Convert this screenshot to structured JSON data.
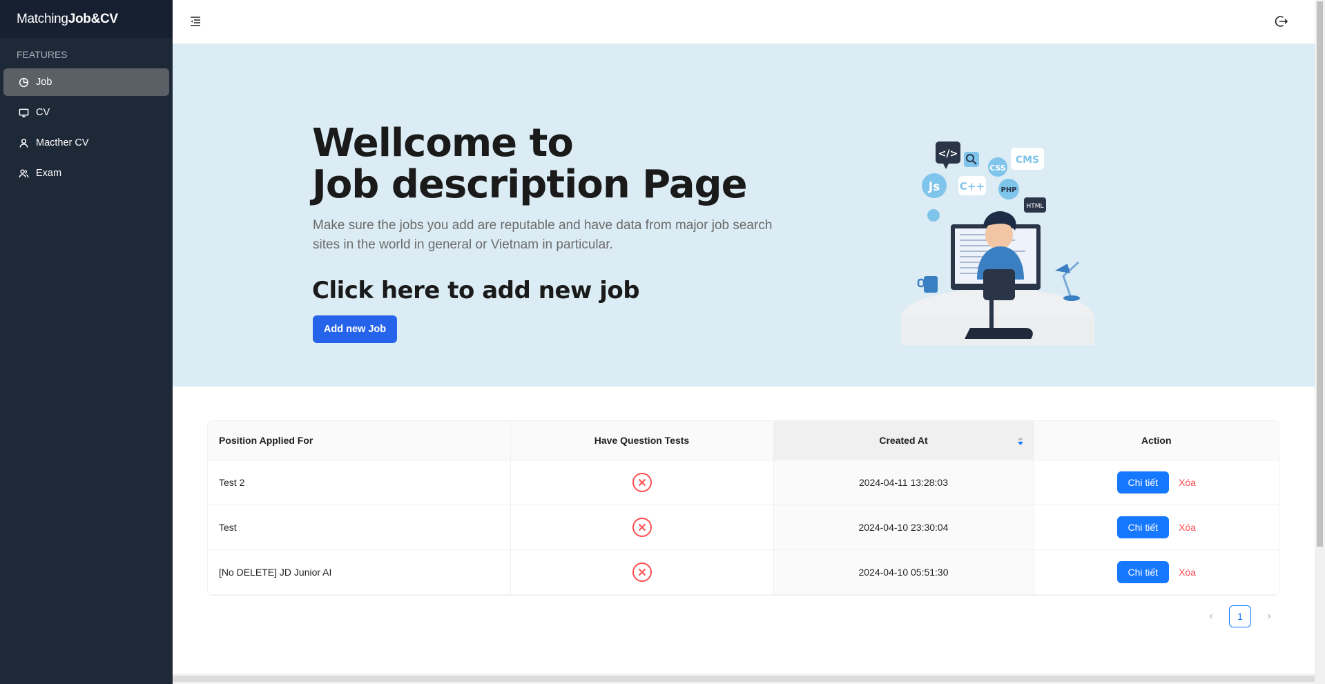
{
  "brand": {
    "prefix": "Matching",
    "bold": "Job&CV"
  },
  "sidebar": {
    "section_label": "FEATURES",
    "items": [
      {
        "label": "Job",
        "icon": "pie-chart-icon",
        "active": true
      },
      {
        "label": "CV",
        "icon": "desktop-icon",
        "active": false
      },
      {
        "label": "Macther CV",
        "icon": "user-icon",
        "active": false
      },
      {
        "label": "Exam",
        "icon": "users-icon",
        "active": false
      }
    ]
  },
  "header": {
    "menu_icon": "menu-fold-icon",
    "logout_icon": "logout-icon"
  },
  "hero": {
    "title_line1": "Wellcome to",
    "title_line2": "Job description Page",
    "subtitle": "Make sure the jobs you add are reputable and have data from major job search sites in the world in general or Vietnam in particular.",
    "cta_heading": "Click here to add new job",
    "cta_button": "Add new Job",
    "illustration_labels": [
      "</>",
      "Js",
      "C++",
      "CSS",
      "CMS",
      "PHP",
      "HTML"
    ]
  },
  "table": {
    "columns": [
      "Position Applied For",
      "Have Question Tests",
      "Created At",
      "Action"
    ],
    "rows": [
      {
        "position": "Test 2",
        "has_tests": false,
        "created_at": "2024-04-11 13:28:03"
      },
      {
        "position": "Test",
        "has_tests": false,
        "created_at": "2024-04-10 23:30:04"
      },
      {
        "position": "[No DELETE] JD Junior AI",
        "has_tests": false,
        "created_at": "2024-04-10 05:51:30"
      }
    ],
    "action_detail": "Chi tiết",
    "action_delete": "Xóa"
  },
  "pagination": {
    "current": "1",
    "prev": "‹",
    "next": "›"
  },
  "colors": {
    "sidebar_bg": "#1e2938",
    "hero_bg": "#dbecf4",
    "primary": "#2563eb",
    "danger": "#ff4d4f"
  }
}
